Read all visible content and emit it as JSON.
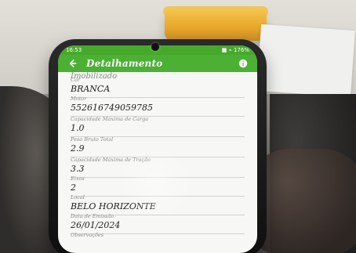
{
  "statusbar": {
    "time": "16:53",
    "right": "■ ⌁ 176%"
  },
  "appbar": {
    "title": "Detalhamento"
  },
  "content": {
    "cut_text": "Imobilizado",
    "fields": [
      {
        "label": "Cor",
        "value": "BRANCA"
      },
      {
        "label": "Motor",
        "value": "552616749059785"
      },
      {
        "label": "Capacidade Máxima de Carga",
        "value": "1.0"
      },
      {
        "label": "Peso Bruto Total",
        "value": "2.9"
      },
      {
        "label": "Capacidade Máxima de Tração",
        "value": "3.3"
      },
      {
        "label": "Eixos",
        "value": "2"
      },
      {
        "label": "Local",
        "value": "BELO HORIZONTE"
      },
      {
        "label": "Data de Emissão",
        "value": "26/01/2024"
      },
      {
        "label": "Observações",
        "value": ""
      }
    ]
  }
}
